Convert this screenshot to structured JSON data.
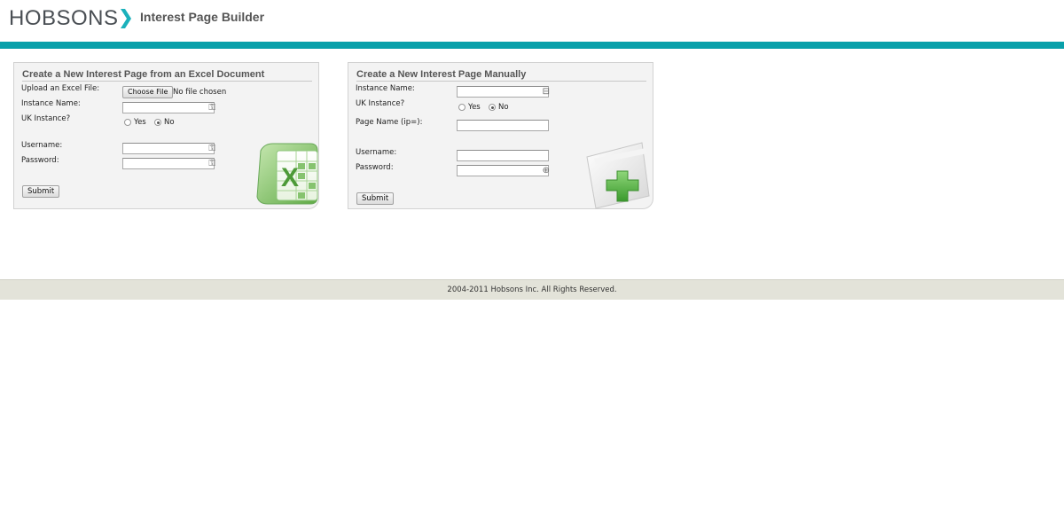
{
  "brand": {
    "logo_text": "HOBSONS",
    "app_title": "Interest Page Builder",
    "accent_color": "#08a0aa"
  },
  "excel_panel": {
    "title": "Create a New Interest Page from an Excel Document",
    "upload_label": "Upload an Excel File:",
    "choose_file_button": "Choose File",
    "file_status": "No file chosen",
    "instance_name_label": "Instance Name:",
    "instance_name_value": "",
    "uk_instance_label": "UK Instance?",
    "uk_yes_label": "Yes",
    "uk_no_label": "No",
    "uk_selected": "No",
    "username_label": "Username:",
    "username_value": "",
    "password_label": "Password:",
    "password_value": "",
    "submit_label": "Submit",
    "icon": "excel-spreadsheet-icon"
  },
  "manual_panel": {
    "title": "Create a New Interest Page Manually",
    "instance_name_label": "Instance Name:",
    "instance_name_value": "",
    "uk_instance_label": "UK Instance?",
    "uk_yes_label": "Yes",
    "uk_no_label": "No",
    "uk_selected": "No",
    "page_name_label": "Page Name (ip=):",
    "page_name_value": "",
    "username_label": "Username:",
    "username_value": "",
    "password_label": "Password:",
    "password_value": "",
    "submit_label": "Submit",
    "icon": "add-page-plus-icon"
  },
  "footer": {
    "copyright": "2004-2011 Hobsons Inc. All Rights Reserved."
  }
}
